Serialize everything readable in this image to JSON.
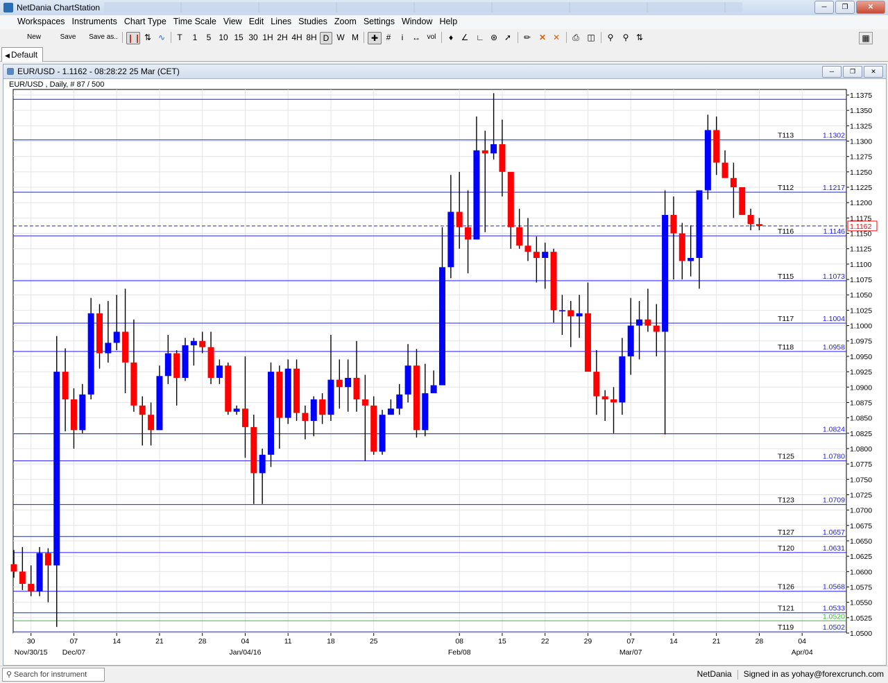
{
  "app": {
    "title": "NetDania ChartStation"
  },
  "menu": [
    "Workspaces",
    "Instruments",
    "Chart Type",
    "Time Scale",
    "View",
    "Edit",
    "Lines",
    "Studies",
    "Zoom",
    "Settings",
    "Window",
    "Help"
  ],
  "toolbar": {
    "new_label": "New",
    "save_label": "Save",
    "save_as_label": "Save as..",
    "timescales": [
      "T",
      "1",
      "5",
      "10",
      "15",
      "30",
      "1H",
      "2H",
      "4H",
      "8H",
      "D",
      "W",
      "M"
    ],
    "active_timescale": "D",
    "volume_label": "vol"
  },
  "tabs": [
    {
      "label": "Default"
    }
  ],
  "chart_window": {
    "title": "EUR/USD - 1.1162 - 08:28:22  25 Mar (CET)",
    "subtitle": "EUR/USD , Daily, # 87 / 500"
  },
  "status": {
    "search_placeholder": "Search for instrument",
    "provider": "NetDania",
    "signed_in": "Signed in as yohay@forexcrunch.com"
  },
  "chart_data": {
    "type": "candlestick",
    "instrument": "EUR/USD",
    "interval": "Daily",
    "ylim": [
      1.05,
      1.1375
    ],
    "y_ticks": [
      "1.0500",
      "1.0525",
      "1.0550",
      "1.0575",
      "1.0600",
      "1.0625",
      "1.0650",
      "1.0675",
      "1.0700",
      "1.0725",
      "1.0750",
      "1.0775",
      "1.0800",
      "1.0825",
      "1.0850",
      "1.0875",
      "1.0900",
      "1.0925",
      "1.0950",
      "1.0975",
      "1.1000",
      "1.1025",
      "1.1050",
      "1.1075",
      "1.1100",
      "1.1125",
      "1.1150",
      "1.1175",
      "1.1200",
      "1.1225",
      "1.1250",
      "1.1275",
      "1.1300",
      "1.1325",
      "1.1350",
      "1.1375"
    ],
    "x_ticks": [
      {
        "label": "30",
        "sub": "Nov/30/15",
        "bar": 2
      },
      {
        "label": "07",
        "sub": "Dec/07",
        "bar": 7
      },
      {
        "label": "14",
        "sub": "",
        "bar": 12
      },
      {
        "label": "21",
        "sub": "",
        "bar": 17
      },
      {
        "label": "28",
        "sub": "",
        "bar": 22
      },
      {
        "label": "04",
        "sub": "Jan/04/16",
        "bar": 27
      },
      {
        "label": "11",
        "sub": "",
        "bar": 32
      },
      {
        "label": "18",
        "sub": "",
        "bar": 37
      },
      {
        "label": "25",
        "sub": "",
        "bar": 42
      },
      {
        "label": "08",
        "sub": "Feb/08",
        "bar": 52
      },
      {
        "label": "15",
        "sub": "",
        "bar": 57
      },
      {
        "label": "22",
        "sub": "",
        "bar": 62
      },
      {
        "label": "29",
        "sub": "",
        "bar": 67
      },
      {
        "label": "07",
        "sub": "Mar/07",
        "bar": 72
      },
      {
        "label": "14",
        "sub": "",
        "bar": 77
      },
      {
        "label": "21",
        "sub": "",
        "bar": 82
      },
      {
        "label": "28",
        "sub": "",
        "bar": 87
      },
      {
        "label": "04",
        "sub": "Apr/04",
        "bar": 92
      }
    ],
    "up_color": "#0000ff",
    "down_color": "#ff0000",
    "grid": true,
    "candles": [
      [
        1.0612,
        1.0635,
        1.059,
        1.06
      ],
      [
        1.06,
        1.064,
        1.057,
        1.058
      ],
      [
        1.058,
        1.061,
        1.056,
        1.0568
      ],
      [
        1.0568,
        1.064,
        1.056,
        1.063
      ],
      [
        1.063,
        1.0638,
        1.055,
        1.061
      ],
      [
        1.061,
        1.0983,
        1.051,
        1.0925
      ],
      [
        1.0925,
        1.0963,
        1.0828,
        1.088
      ],
      [
        1.088,
        1.0898,
        1.08,
        1.083
      ],
      [
        1.083,
        1.0905,
        1.0825,
        1.0888
      ],
      [
        1.0888,
        1.1045,
        1.088,
        1.102
      ],
      [
        1.102,
        1.1035,
        1.093,
        1.0955
      ],
      [
        1.0955,
        1.104,
        1.094,
        1.0972
      ],
      [
        1.0972,
        1.105,
        1.096,
        1.099
      ],
      [
        1.099,
        1.106,
        1.089,
        1.094
      ],
      [
        1.094,
        1.101,
        1.086,
        1.087
      ],
      [
        1.087,
        1.0885,
        1.0805,
        1.0855
      ],
      [
        1.0855,
        1.0875,
        1.0805,
        1.083
      ],
      [
        1.083,
        1.0935,
        1.0845,
        1.0918
      ],
      [
        1.0918,
        1.0985,
        1.0905,
        1.0955
      ],
      [
        1.0955,
        1.096,
        1.087,
        1.0915
      ],
      [
        1.0915,
        1.098,
        1.091,
        1.0968
      ],
      [
        1.0968,
        1.098,
        1.0935,
        1.0975
      ],
      [
        1.0975,
        1.099,
        1.0955,
        1.0965
      ],
      [
        1.0965,
        1.099,
        1.0905,
        1.0915
      ],
      [
        1.0915,
        1.0945,
        1.0905,
        1.0935
      ],
      [
        1.0935,
        1.094,
        1.0855,
        1.086
      ],
      [
        1.086,
        1.087,
        1.0855,
        1.0865
      ],
      [
        1.0865,
        1.095,
        1.0785,
        1.0835
      ],
      [
        1.0835,
        1.0855,
        1.071,
        1.076
      ],
      [
        1.076,
        1.08,
        1.071,
        1.079
      ],
      [
        1.079,
        1.094,
        1.077,
        1.0925
      ],
      [
        1.0925,
        1.0935,
        1.08,
        1.085
      ],
      [
        1.085,
        1.0945,
        1.084,
        1.093
      ],
      [
        1.093,
        1.0945,
        1.0845,
        1.0858
      ],
      [
        1.0858,
        1.087,
        1.0815,
        1.0845
      ],
      [
        1.0845,
        1.0885,
        1.082,
        1.088
      ],
      [
        1.088,
        1.089,
        1.084,
        1.0855
      ],
      [
        1.0855,
        1.0985,
        1.0845,
        1.0912
      ],
      [
        1.0912,
        1.0945,
        1.0865,
        1.09
      ],
      [
        1.09,
        1.0945,
        1.086,
        1.0915
      ],
      [
        1.0915,
        1.0975,
        1.086,
        1.088
      ],
      [
        1.088,
        1.092,
        1.078,
        1.087
      ],
      [
        1.087,
        1.0885,
        1.079,
        1.0795
      ],
      [
        1.0795,
        1.0863,
        1.079,
        1.0855
      ],
      [
        1.0855,
        1.088,
        1.0855,
        1.0865
      ],
      [
        1.0865,
        1.0905,
        1.0855,
        1.0888
      ],
      [
        1.0888,
        1.097,
        1.0875,
        1.0935
      ],
      [
        1.0935,
        1.0962,
        1.0818,
        1.083
      ],
      [
        1.083,
        1.0938,
        1.082,
        1.089
      ],
      [
        1.089,
        1.0927,
        1.0895,
        1.0903
      ],
      [
        1.0903,
        1.116,
        1.0905,
        1.1095
      ],
      [
        1.1095,
        1.1245,
        1.1077,
        1.1185
      ],
      [
        1.1185,
        1.125,
        1.1125,
        1.116
      ],
      [
        1.116,
        1.122,
        1.1085,
        1.114
      ],
      [
        1.114,
        1.134,
        1.1145,
        1.1285
      ],
      [
        1.1285,
        1.1317,
        1.1152,
        1.128
      ],
      [
        1.128,
        1.1378,
        1.127,
        1.1295
      ],
      [
        1.1295,
        1.1335,
        1.121,
        1.125
      ],
      [
        1.125,
        1.123,
        1.1125,
        1.116
      ],
      [
        1.116,
        1.119,
        1.1125,
        1.113
      ],
      [
        1.113,
        1.1175,
        1.1105,
        1.112
      ],
      [
        1.112,
        1.1145,
        1.107,
        1.111
      ],
      [
        1.111,
        1.1135,
        1.106,
        1.112
      ],
      [
        1.112,
        1.1125,
        1.1005,
        1.1025
      ],
      [
        1.1025,
        1.105,
        1.0985,
        1.1025
      ],
      [
        1.1025,
        1.104,
        1.0965,
        1.1015
      ],
      [
        1.1015,
        1.105,
        1.098,
        1.102
      ],
      [
        1.102,
        1.107,
        1.0932,
        1.0925
      ],
      [
        1.0925,
        1.096,
        1.0855,
        1.0885
      ],
      [
        1.0885,
        1.0895,
        1.0845,
        1.088
      ],
      [
        1.088,
        1.09,
        1.0825,
        1.0875
      ],
      [
        1.0875,
        1.098,
        1.0855,
        1.095
      ],
      [
        1.095,
        1.1045,
        1.092,
        1.1
      ],
      [
        1.1,
        1.104,
        1.0945,
        1.101
      ],
      [
        1.101,
        1.106,
        1.099,
        1.1
      ],
      [
        1.1,
        1.1035,
        1.095,
        1.099
      ],
      [
        1.099,
        1.122,
        1.0823,
        1.118
      ],
      [
        1.118,
        1.121,
        1.1075,
        1.115
      ],
      [
        1.115,
        1.1167,
        1.1075,
        1.1105
      ],
      [
        1.1105,
        1.1163,
        1.108,
        1.111
      ],
      [
        1.111,
        1.118,
        1.106,
        1.122
      ],
      [
        1.122,
        1.1343,
        1.1205,
        1.1318
      ],
      [
        1.1318,
        1.134,
        1.1245,
        1.1265
      ],
      [
        1.1265,
        1.1285,
        1.1245,
        1.124
      ],
      [
        1.124,
        1.1265,
        1.1175,
        1.1225
      ],
      [
        1.1225,
        1.122,
        1.1195,
        1.118
      ],
      [
        1.118,
        1.119,
        1.1155,
        1.1165
      ],
      [
        1.1165,
        1.1175,
        1.1155,
        1.1162
      ]
    ],
    "hlines": [
      {
        "label": "",
        "value": 1.1368,
        "price_label": "",
        "color": "#1c1cff"
      },
      {
        "label": "T113",
        "value": 1.1302,
        "price_label": "1.1302",
        "color": "#1c1cff"
      },
      {
        "label": "T112",
        "value": 1.1217,
        "price_label": "1.1217",
        "color": "#1c1cff"
      },
      {
        "label": "T116",
        "value": 1.1146,
        "price_label": "1.1146",
        "color": "#1c1cff"
      },
      {
        "label": "T115",
        "value": 1.1073,
        "price_label": "1.1073",
        "color": "#1c1cff"
      },
      {
        "label": "T117",
        "value": 1.1004,
        "price_label": "1.1004",
        "color": "#1c1cff"
      },
      {
        "label": "T118",
        "value": 1.0958,
        "price_label": "1.0958",
        "color": "#1c1cff"
      },
      {
        "label": "",
        "value": 1.0824,
        "price_label": "1.0824",
        "color": "#1c1cff"
      },
      {
        "label": "T125",
        "value": 1.078,
        "price_label": "1.0780",
        "color": "#1c1cff"
      },
      {
        "label": "T123",
        "value": 1.0709,
        "price_label": "1.0709",
        "color": "#1c1cff"
      },
      {
        "label": "T127",
        "value": 1.0657,
        "price_label": "1.0657",
        "color": "#1c1cff"
      },
      {
        "label": "T120",
        "value": 1.0631,
        "price_label": "1.0631",
        "color": "#1c1cff"
      },
      {
        "label": "T126",
        "value": 1.0568,
        "price_label": "1.0568",
        "color": "#1c1cff"
      },
      {
        "label": "T121",
        "value": 1.0533,
        "price_label": "1.0533",
        "color": "#1c1cff"
      },
      {
        "label": "",
        "value": 1.052,
        "price_label": "1.0520",
        "color": "#2ec12e"
      },
      {
        "label": "T119",
        "value": 1.0502,
        "price_label": "1.0502",
        "color": "#1c1cff"
      }
    ],
    "current_price": {
      "value": 1.1162,
      "label": "1.1162",
      "color": "#1c1cff",
      "box_color": "#ff0000"
    }
  }
}
